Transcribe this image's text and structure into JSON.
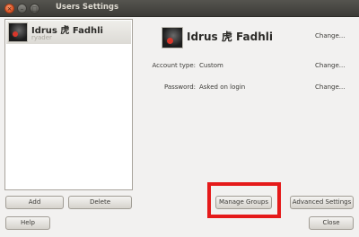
{
  "window": {
    "title": "Users Settings",
    "close_symbol": "×",
    "min_symbol": "–",
    "max_symbol": "□"
  },
  "user_list": {
    "items": [
      {
        "name": "Idrus 虎 Fadhli",
        "login": "ryader"
      }
    ]
  },
  "buttons": {
    "add": "Add",
    "delete": "Delete",
    "help": "Help",
    "manage_groups": "Manage Groups",
    "advanced_settings": "Advanced Settings",
    "close": "Close"
  },
  "details": {
    "full_name": "Idrus 虎 Fadhli",
    "change_name": "Change...",
    "account_type_label": "Account type:",
    "account_type_value": "Custom",
    "change_account_type": "Change...",
    "password_label": "Password:",
    "password_value": "Asked on login",
    "change_password": "Change..."
  },
  "colors": {
    "highlight": "#e51a1a",
    "titlebar": "#3c3b37",
    "close_button": "#e2582a"
  }
}
